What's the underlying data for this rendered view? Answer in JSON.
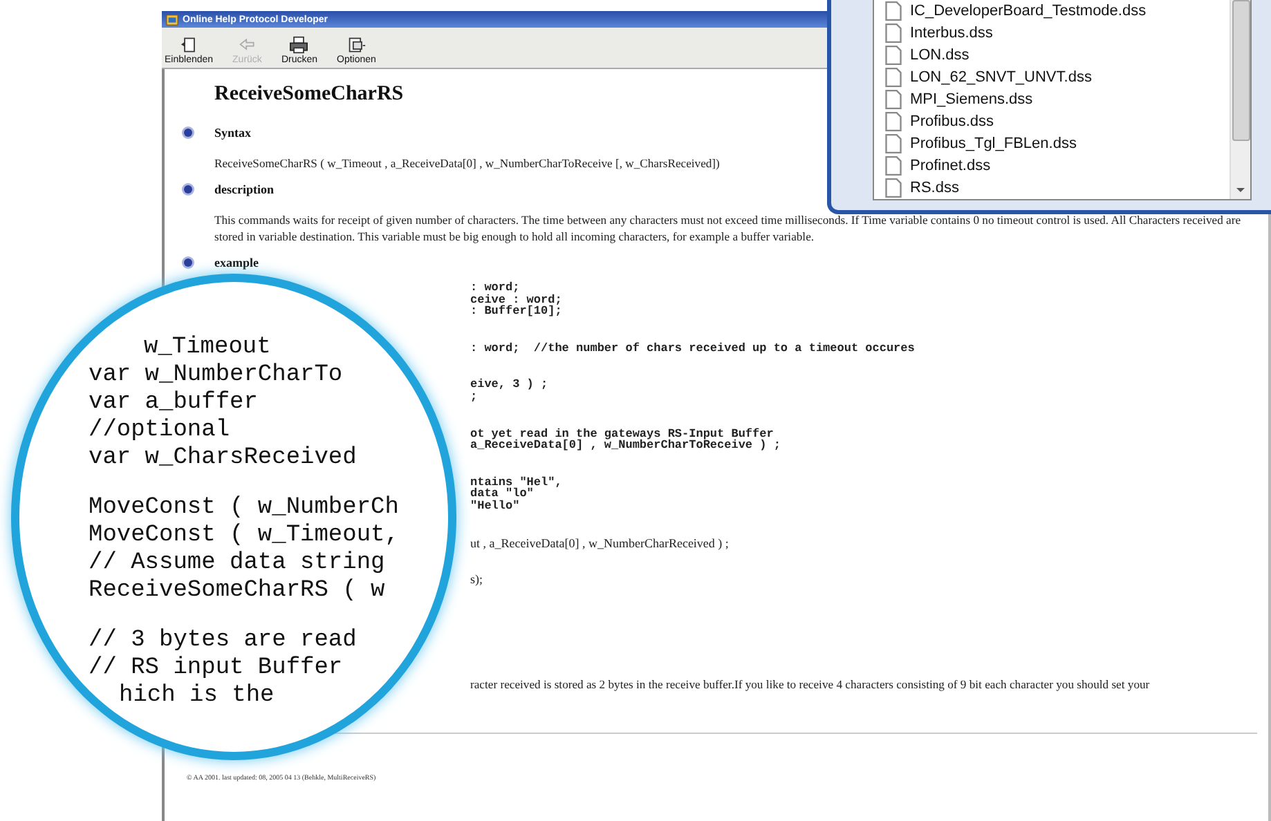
{
  "window": {
    "title": "Online Help Protocol Developer"
  },
  "toolbar": [
    {
      "kind": "show",
      "label": "Einblenden",
      "disabled": false
    },
    {
      "kind": "back",
      "label": "Zurück",
      "disabled": true
    },
    {
      "kind": "print",
      "label": "Drucken",
      "disabled": false
    },
    {
      "kind": "options",
      "label": "Optionen",
      "disabled": false
    }
  ],
  "page": {
    "heading": "ReceiveSomeCharRS",
    "sections": [
      {
        "title": "Syntax",
        "text": "ReceiveSomeCharRS ( w_Timeout , a_ReceiveData[0] , w_NumberCharToReceive [, w_CharsReceived])"
      },
      {
        "title": "description",
        "text": "This commands waits for receipt of given number of characters. The time between any characters must not exceed time milliseconds. If Time variable contains 0 no timeout control is used. All Characters received are stored in variable destination. This variable must be big enough to hold all incoming characters, for example a buffer variable."
      },
      {
        "title": "example"
      }
    ],
    "code_blocks": [
      {
        "kind": "mono",
        "lines": [
          ": word;",
          "ceive : word;",
          ": Buffer[10];"
        ]
      },
      {
        "kind": "mono",
        "lines": [
          ": word;  //the number of chars received up to a timeout occures"
        ]
      },
      {
        "kind": "mono",
        "lines": [
          "eive, 3 ) ;",
          ";"
        ]
      },
      {
        "kind": "mono",
        "lines": [
          "ot yet read in the gateways RS-Input Buffer",
          "a_ReceiveData[0] , w_NumberCharToReceive ) ;"
        ]
      },
      {
        "kind": "mono",
        "lines": [
          "ntains \"Hel\",",
          "data \"lo\"",
          "\"Hello\""
        ]
      },
      {
        "kind": "serif",
        "lines": [
          "ut , a_ReceiveData[0] , w_NumberCharReceived ) ;"
        ]
      },
      {
        "kind": "serif",
        "lines": [
          "s);"
        ]
      }
    ],
    "note": "racter received is stored as 2 bytes in the receive buffer.If you like to receive 4 characters consisting of 9 bit each character you should set your",
    "footer": "© AA 2001. last updated: 08, 2005 04 13 (Behkle, MultiReceiveRS)"
  },
  "magnifier": {
    "blocks": [
      [
        "w_Timeout",
        "var w_NumberCharTo",
        "var a_buffer",
        "//optional",
        "var w_CharsReceived"
      ],
      [
        "MoveConst ( w_NumberCh",
        "MoveConst ( w_Timeout,",
        "// Assume data string",
        "ReceiveSomeCharRS ( w"
      ],
      [
        "// 3 bytes are read",
        "// RS input Buffer",
        "hich is the"
      ]
    ]
  },
  "file_list": {
    "items": [
      "IC_DeveloperBoard_Testmode.dss",
      "Interbus.dss",
      "LON.dss",
      "LON_62_SNVT_UNVT.dss",
      "MPI_Siemens.dss",
      "Profibus.dss",
      "Profibus_Tgl_FBLen.dss",
      "Profinet.dss",
      "RS.dss"
    ]
  }
}
